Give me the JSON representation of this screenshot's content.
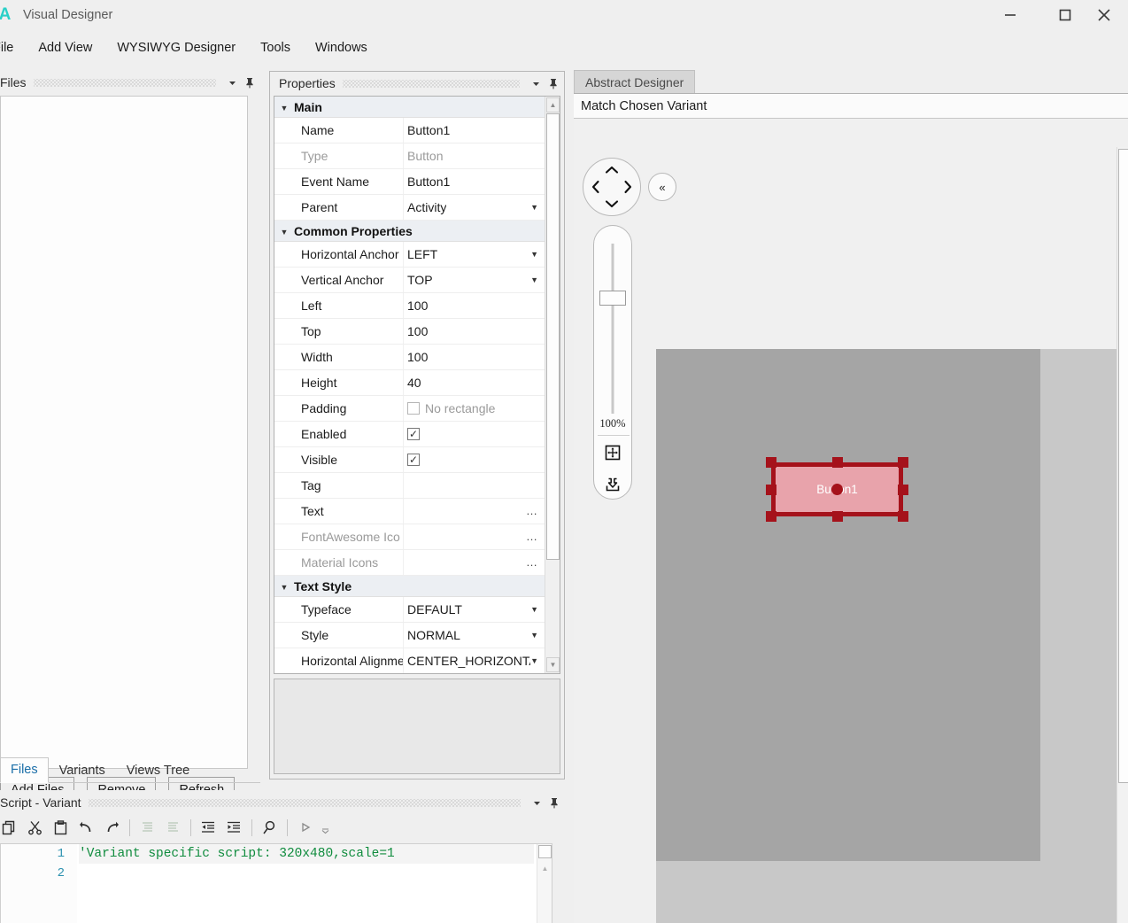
{
  "window": {
    "title": "Visual Designer",
    "logo_letter": "A",
    "logo_color": "#2ad0c8",
    "controls": [
      {
        "name": "minimize",
        "glyph": "—"
      },
      {
        "name": "maximize",
        "glyph": "□"
      },
      {
        "name": "close",
        "glyph": "✕"
      }
    ]
  },
  "menubar": {
    "items": [
      {
        "label": "File"
      },
      {
        "label": "Add View"
      },
      {
        "label": "WYSIWYG Designer"
      },
      {
        "label": "Tools"
      },
      {
        "label": "Windows"
      }
    ]
  },
  "files_panel": {
    "title": "Files",
    "auto_hide_icon": "chevron-down-icon",
    "pin_icon": "pin-icon",
    "buttons": [
      {
        "label": "Add Files"
      },
      {
        "label": "Remove"
      },
      {
        "label": "Refresh"
      }
    ],
    "tabs": [
      {
        "label": "Files",
        "active": true
      },
      {
        "label": "Variants",
        "active": false
      },
      {
        "label": "Views Tree",
        "active": false
      }
    ]
  },
  "properties_panel": {
    "title": "Properties",
    "auto_hide_icon": "chevron-down-icon",
    "pin_icon": "pin-icon",
    "groups": [
      {
        "name": "Main",
        "expanded": true,
        "rows": [
          {
            "name": "Name",
            "value": "Button1",
            "kind": "text"
          },
          {
            "name": "Type",
            "value": "Button",
            "kind": "text",
            "disabled": true
          },
          {
            "name": "Event Name",
            "value": "Button1",
            "kind": "text"
          },
          {
            "name": "Parent",
            "value": "Activity",
            "kind": "combo"
          }
        ]
      },
      {
        "name": "Common Properties",
        "expanded": true,
        "rows": [
          {
            "name": "Horizontal Anchor",
            "value": "LEFT",
            "kind": "combo"
          },
          {
            "name": "Vertical Anchor",
            "value": "TOP",
            "kind": "combo"
          },
          {
            "name": "Left",
            "value": "100",
            "kind": "text"
          },
          {
            "name": "Top",
            "value": "100",
            "kind": "text"
          },
          {
            "name": "Width",
            "value": "100",
            "kind": "text"
          },
          {
            "name": "Height",
            "value": "40",
            "kind": "text"
          },
          {
            "name": "Padding",
            "value": "No rectangle",
            "kind": "checkbox",
            "checked": false
          },
          {
            "name": "Enabled",
            "value": "",
            "kind": "checkbox",
            "checked": true
          },
          {
            "name": "Visible",
            "value": "",
            "kind": "checkbox",
            "checked": true
          },
          {
            "name": "Tag",
            "value": "",
            "kind": "text"
          },
          {
            "name": "Text",
            "value": "",
            "kind": "ellipsis"
          },
          {
            "name": "FontAwesome Ico",
            "value": "",
            "kind": "ellipsis",
            "disabled": true
          },
          {
            "name": "Material Icons",
            "value": "",
            "kind": "ellipsis",
            "disabled": true
          }
        ]
      },
      {
        "name": "Text Style",
        "expanded": true,
        "rows": [
          {
            "name": "Typeface",
            "value": "DEFAULT",
            "kind": "combo"
          },
          {
            "name": "Style",
            "value": "NORMAL",
            "kind": "combo"
          },
          {
            "name": "Horizontal Alignment",
            "value": "CENTER_HORIZONTAL",
            "kind": "combo"
          }
        ]
      }
    ]
  },
  "script_panel": {
    "title": "Script - Variant",
    "auto_hide_icon": "chevron-down-icon",
    "pin_icon": "pin-icon",
    "toolbar": [
      {
        "name": "copy-icon",
        "enabled": true
      },
      {
        "name": "cut-icon",
        "enabled": true
      },
      {
        "name": "paste-icon",
        "enabled": true
      },
      {
        "name": "undo-icon",
        "enabled": true
      },
      {
        "name": "redo-icon",
        "enabled": true
      },
      {
        "name": "comment-icon",
        "enabled": false
      },
      {
        "name": "uncomment-icon",
        "enabled": false
      },
      {
        "name": "outdent-icon",
        "enabled": true
      },
      {
        "name": "indent-icon",
        "enabled": true
      },
      {
        "name": "search-icon",
        "enabled": true
      },
      {
        "name": "run-icon",
        "enabled": true
      },
      {
        "name": "overflow-icon",
        "enabled": true
      }
    ],
    "lines": [
      {
        "number": "1",
        "text": "'Variant specific script: 320x480,scale=1",
        "comment": true
      },
      {
        "number": "2",
        "text": "",
        "comment": false
      }
    ]
  },
  "abstract_designer": {
    "tabs": [
      {
        "label": "Abstract Designer",
        "active": true
      }
    ],
    "variant_bar_label": "Match Chosen Variant",
    "nav_pad": {
      "up": "∧",
      "down": "∨",
      "left": "‹",
      "right": "›"
    },
    "collapse_label": "«",
    "zoom": {
      "value": "100%"
    },
    "zoom_buttons": [
      {
        "name": "fit-to-view-icon"
      },
      {
        "name": "save-snapshot-icon"
      }
    ],
    "canvas": {
      "background": "#a5a5a5",
      "outer_background": "#c8c8c8"
    },
    "selected_view": {
      "text": "Button1",
      "fill": "#e8a3ab",
      "border": "#a5121b",
      "handle_color": "#a5121b"
    }
  }
}
